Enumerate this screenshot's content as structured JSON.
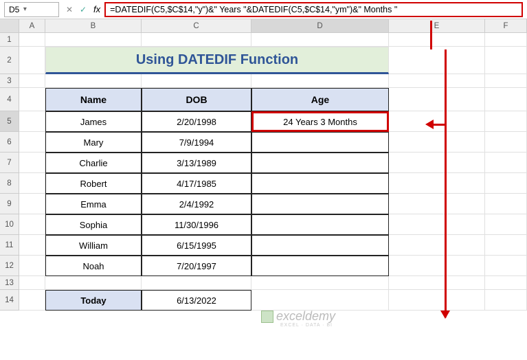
{
  "namebox": {
    "value": "D5"
  },
  "formulabar": {
    "value": "=DATEDIF(C5,$C$14,\"y\")&\" Years \"&DATEDIF(C5,$C$14,\"ym\")&\" Months \""
  },
  "colheaders": {
    "A": "A",
    "B": "B",
    "C": "C",
    "D": "D",
    "E": "E",
    "F": "F"
  },
  "rowheaders": [
    "1",
    "2",
    "3",
    "4",
    "5",
    "6",
    "7",
    "8",
    "9",
    "10",
    "11",
    "12",
    "13",
    "14"
  ],
  "title": "Using DATEDIF Function",
  "headers": {
    "name": "Name",
    "dob": "DOB",
    "age": "Age"
  },
  "data": [
    {
      "name": "James",
      "dob": "2/20/1998",
      "age": "24 Years 3 Months"
    },
    {
      "name": "Mary",
      "dob": "7/9/1994",
      "age": ""
    },
    {
      "name": "Charlie",
      "dob": "3/13/1989",
      "age": ""
    },
    {
      "name": "Robert",
      "dob": "4/17/1985",
      "age": ""
    },
    {
      "name": "Emma",
      "dob": "2/4/1992",
      "age": ""
    },
    {
      "name": "Sophia",
      "dob": "11/30/1996",
      "age": ""
    },
    {
      "name": "William",
      "dob": "6/15/1995",
      "age": ""
    },
    {
      "name": "Noah",
      "dob": "7/20/1997",
      "age": ""
    }
  ],
  "today": {
    "label": "Today",
    "value": "6/13/2022"
  },
  "watermark": {
    "text": "exceldemy",
    "sub": "EXCEL · DATA · BI"
  }
}
